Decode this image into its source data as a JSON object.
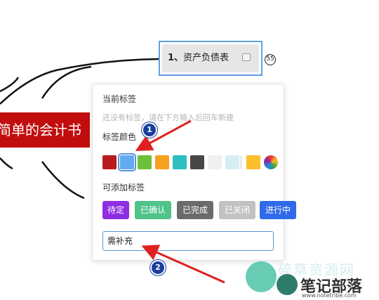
{
  "mindmap": {
    "central_topic": "简单的会计书",
    "topic": {
      "number": "1、",
      "label": "资产负债表"
    },
    "count_badge": "55"
  },
  "tag_panel": {
    "current_tags_label": "当前标签",
    "no_tags_hint": "还没有标签，请在下方输入后回车新建",
    "tag_color_label": "标签颜色",
    "swatches": [
      {
        "name": "red",
        "color": "#b71c1c"
      },
      {
        "name": "blue",
        "color": "#64aaf0",
        "selected": true
      },
      {
        "name": "green",
        "color": "#6cc03a"
      },
      {
        "name": "orange",
        "color": "#f5a11f"
      },
      {
        "name": "teal",
        "color": "#2dbfbf"
      },
      {
        "name": "dark-gray",
        "color": "#474747"
      },
      {
        "name": "light-gray",
        "color": "#f0f0f0"
      },
      {
        "name": "light-cyan",
        "color": "#d6eef3"
      },
      {
        "name": "yellow",
        "color": "#fbbe2d"
      }
    ],
    "addable_tags_label": "可添加标签",
    "tags": [
      {
        "label": "待定",
        "color": "#8e2de2"
      },
      {
        "label": "已确认",
        "color": "#4fc38a"
      },
      {
        "label": "已完成",
        "color": "#6b6b6b"
      },
      {
        "label": "已关闭",
        "color": "#c2c2c2"
      },
      {
        "label": "进行中",
        "color": "#2f6ae8"
      }
    ],
    "input_value": "需补充"
  },
  "annotations": {
    "step1": "1",
    "step2": "2"
  },
  "watermark": {
    "faded_text": "碎草资源网",
    "title": "笔记部落",
    "url": "www.notetribe.com"
  }
}
